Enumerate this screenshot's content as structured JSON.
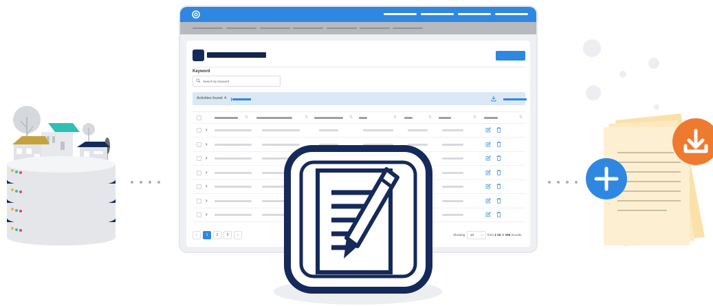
{
  "app": {
    "keyword_label": "Keyword",
    "search_placeholder": "Search by keyword",
    "activities_text": "Activities found: 4",
    "pagination": {
      "prev": "‹",
      "pages": [
        "1",
        "2",
        "3"
      ],
      "next": "›",
      "active_page": "1",
      "showing_label": "Showing",
      "page_size": "10",
      "range_prefix": "from",
      "range_start": "1",
      "range_sep": "-",
      "range_end": "10",
      "range_of": "of",
      "total": "100",
      "range_suffix": "records"
    }
  },
  "icons": {
    "logo": "spiral-logo-icon",
    "search": "search-icon",
    "download": "download-icon",
    "row_expand": "chevron-right-icon",
    "row_edit": "edit-icon",
    "row_delete": "trash-icon",
    "sort": "sort-arrows-icon",
    "hero": "document-edit-icon",
    "add": "plus-icon",
    "file_download": "download-icon"
  },
  "colors": {
    "primary": "#2f87e2",
    "navy": "#15264b",
    "highlight_bar": "#dbe8f6",
    "orange": "#ee7a30",
    "paper": "#fbe7bd"
  }
}
